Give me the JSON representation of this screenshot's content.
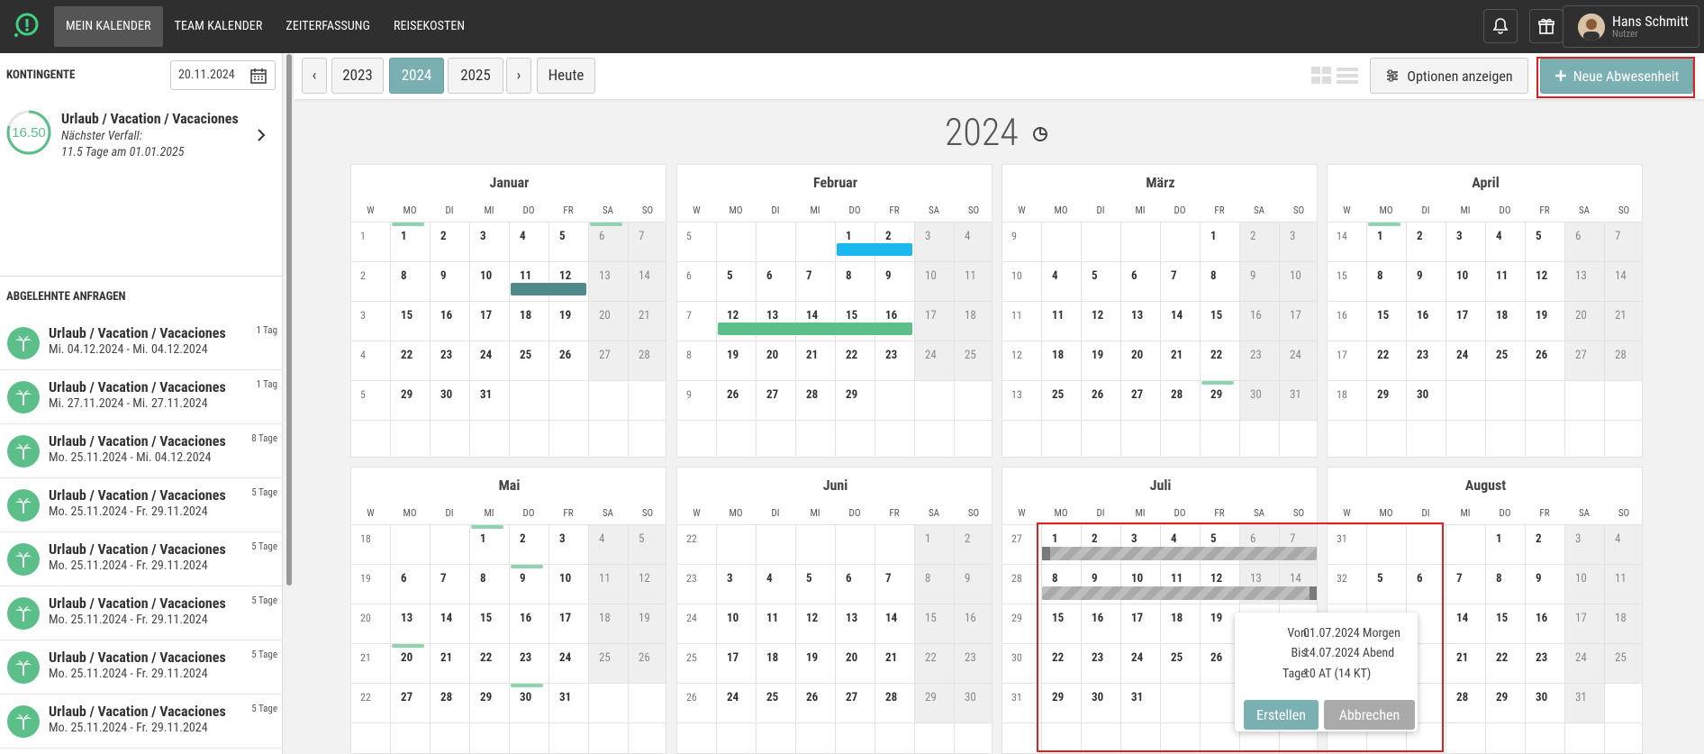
{
  "nav": {
    "items": [
      "MEIN KALENDER",
      "TEAM KALENDER",
      "ZEITERFASSUNG",
      "REISEKOSTEN"
    ]
  },
  "user": {
    "name": "Hans Schmitt",
    "role": "Nutzer"
  },
  "sidebar": {
    "kontingente_title": "KONTINGENTE",
    "date_value": "20.11.2024",
    "kontingent": {
      "value": "16.50",
      "fraction": 0.8,
      "title": "Urlaub / Vacation / Vacaciones",
      "line1": "Nächster Verfall:",
      "line2": "11.5 Tage am 01.01.2025"
    },
    "rejected_title": "ABGELEHNTE ANFRAGEN",
    "requests": [
      {
        "title": "Urlaub / Vacation / Vacaciones",
        "dates": "Mi. 04.12.2024 - Mi. 04.12.2024",
        "days": "1 Tag"
      },
      {
        "title": "Urlaub / Vacation / Vacaciones",
        "dates": "Mi. 27.11.2024 - Mi. 27.11.2024",
        "days": "1 Tag"
      },
      {
        "title": "Urlaub / Vacation / Vacaciones",
        "dates": "Mo. 25.11.2024 - Mi. 04.12.2024",
        "days": "8 Tage"
      },
      {
        "title": "Urlaub / Vacation / Vacaciones",
        "dates": "Mo. 25.11.2024 - Fr. 29.11.2024",
        "days": "5 Tage"
      },
      {
        "title": "Urlaub / Vacation / Vacaciones",
        "dates": "Mo. 25.11.2024 - Fr. 29.11.2024",
        "days": "5 Tage"
      },
      {
        "title": "Urlaub / Vacation / Vacaciones",
        "dates": "Mo. 25.11.2024 - Fr. 29.11.2024",
        "days": "5 Tage"
      },
      {
        "title": "Urlaub / Vacation / Vacaciones",
        "dates": "Mo. 25.11.2024 - Fr. 29.11.2024",
        "days": "5 Tage"
      },
      {
        "title": "Urlaub / Vacation / Vacaciones",
        "dates": "Mo. 25.11.2024 - Fr. 29.11.2024",
        "days": "5 Tage"
      }
    ]
  },
  "toolbar": {
    "prev_label": "‹",
    "years": [
      "2023",
      "2024",
      "2025"
    ],
    "next_label": "›",
    "today_label": "Heute",
    "options_label": "Optionen anzeigen",
    "new_absence_label": "Neue Abwesenheit"
  },
  "calendar": {
    "year": "2024",
    "weekday_labels": [
      "W",
      "MO",
      "DI",
      "MI",
      "DO",
      "FR",
      "SA",
      "SO"
    ],
    "months": [
      {
        "name": "Januar",
        "weeks": [
          {
            "kw": "1",
            "days": [
              "",
              "1",
              "2",
              "3",
              "4",
              "5",
              "6",
              "7"
            ]
          },
          {
            "kw": "2",
            "days": [
              "",
              "8",
              "9",
              "10",
              "11",
              "12",
              "13",
              "14"
            ]
          },
          {
            "kw": "3",
            "days": [
              "",
              "15",
              "16",
              "17",
              "18",
              "19",
              "20",
              "21"
            ]
          },
          {
            "kw": "4",
            "days": [
              "",
              "22",
              "23",
              "24",
              "25",
              "26",
              "27",
              "28"
            ]
          },
          {
            "kw": "5",
            "days": [
              "",
              "29",
              "30",
              "31",
              "",
              "",
              "",
              ""
            ]
          }
        ]
      },
      {
        "name": "Februar",
        "weeks": [
          {
            "kw": "5",
            "days": [
              "",
              "",
              "",
              "",
              "1",
              "2",
              "3",
              "4"
            ]
          },
          {
            "kw": "6",
            "days": [
              "",
              "5",
              "6",
              "7",
              "8",
              "9",
              "10",
              "11"
            ]
          },
          {
            "kw": "7",
            "days": [
              "",
              "12",
              "13",
              "14",
              "15",
              "16",
              "17",
              "18"
            ]
          },
          {
            "kw": "8",
            "days": [
              "",
              "19",
              "20",
              "21",
              "22",
              "23",
              "24",
              "25"
            ]
          },
          {
            "kw": "9",
            "days": [
              "",
              "26",
              "27",
              "28",
              "29",
              "",
              "",
              ""
            ]
          }
        ]
      },
      {
        "name": "März",
        "weeks": [
          {
            "kw": "9",
            "days": [
              "",
              "",
              "",
              "",
              "",
              "1",
              "2",
              "3"
            ]
          },
          {
            "kw": "10",
            "days": [
              "",
              "4",
              "5",
              "6",
              "7",
              "8",
              "9",
              "10"
            ]
          },
          {
            "kw": "11",
            "days": [
              "",
              "11",
              "12",
              "13",
              "14",
              "15",
              "16",
              "17"
            ]
          },
          {
            "kw": "12",
            "days": [
              "",
              "18",
              "19",
              "20",
              "21",
              "22",
              "23",
              "24"
            ]
          },
          {
            "kw": "13",
            "days": [
              "",
              "25",
              "26",
              "27",
              "28",
              "29",
              "30",
              "31"
            ]
          }
        ]
      },
      {
        "name": "April",
        "weeks": [
          {
            "kw": "14",
            "days": [
              "",
              "1",
              "2",
              "3",
              "4",
              "5",
              "6",
              "7"
            ]
          },
          {
            "kw": "15",
            "days": [
              "",
              "8",
              "9",
              "10",
              "11",
              "12",
              "13",
              "14"
            ]
          },
          {
            "kw": "16",
            "days": [
              "",
              "15",
              "16",
              "17",
              "18",
              "19",
              "20",
              "21"
            ]
          },
          {
            "kw": "17",
            "days": [
              "",
              "22",
              "23",
              "24",
              "25",
              "26",
              "27",
              "28"
            ]
          },
          {
            "kw": "18",
            "days": [
              "",
              "29",
              "30",
              "",
              "",
              "",
              "",
              ""
            ]
          }
        ]
      },
      {
        "name": "Mai",
        "weeks": [
          {
            "kw": "18",
            "days": [
              "",
              "",
              "",
              "1",
              "2",
              "3",
              "4",
              "5"
            ]
          },
          {
            "kw": "19",
            "days": [
              "",
              "6",
              "7",
              "8",
              "9",
              "10",
              "11",
              "12"
            ]
          },
          {
            "kw": "20",
            "days": [
              "",
              "13",
              "14",
              "15",
              "16",
              "17",
              "18",
              "19"
            ]
          },
          {
            "kw": "21",
            "days": [
              "",
              "20",
              "21",
              "22",
              "23",
              "24",
              "25",
              "26"
            ]
          },
          {
            "kw": "22",
            "days": [
              "",
              "27",
              "28",
              "29",
              "30",
              "31",
              "",
              ""
            ]
          }
        ]
      },
      {
        "name": "Juni",
        "weeks": [
          {
            "kw": "22",
            "days": [
              "",
              "",
              "",
              "",
              "",
              "",
              "1",
              "2"
            ]
          },
          {
            "kw": "23",
            "days": [
              "",
              "3",
              "4",
              "5",
              "6",
              "7",
              "8",
              "9"
            ]
          },
          {
            "kw": "24",
            "days": [
              "",
              "10",
              "11",
              "12",
              "13",
              "14",
              "15",
              "16"
            ]
          },
          {
            "kw": "25",
            "days": [
              "",
              "17",
              "18",
              "19",
              "20",
              "21",
              "22",
              "23"
            ]
          },
          {
            "kw": "26",
            "days": [
              "",
              "24",
              "25",
              "26",
              "27",
              "28",
              "29",
              "30"
            ]
          }
        ]
      },
      {
        "name": "Juli",
        "weeks": [
          {
            "kw": "27",
            "days": [
              "",
              "1",
              "2",
              "3",
              "4",
              "5",
              "6",
              "7"
            ]
          },
          {
            "kw": "28",
            "days": [
              "",
              "8",
              "9",
              "10",
              "11",
              "12",
              "13",
              "14"
            ]
          },
          {
            "kw": "29",
            "days": [
              "",
              "15",
              "16",
              "17",
              "18",
              "19",
              "",
              ""
            ]
          },
          {
            "kw": "30",
            "days": [
              "",
              "22",
              "23",
              "24",
              "25",
              "26",
              "",
              ""
            ]
          },
          {
            "kw": "31",
            "days": [
              "",
              "29",
              "30",
              "31",
              "",
              "",
              "",
              ""
            ]
          }
        ]
      },
      {
        "name": "August",
        "weeks": [
          {
            "kw": "31",
            "days": [
              "",
              "",
              "",
              "",
              "1",
              "2",
              "3",
              "4"
            ]
          },
          {
            "kw": "32",
            "days": [
              "",
              "5",
              "6",
              "7",
              "8",
              "9",
              "10",
              "11"
            ]
          },
          {
            "kw": "",
            "days": [
              "",
              "",
              "",
              "14",
              "15",
              "16",
              "17",
              "18"
            ]
          },
          {
            "kw": "",
            "days": [
              "",
              "",
              "",
              "21",
              "22",
              "23",
              "24",
              "25"
            ]
          },
          {
            "kw": "",
            "days": [
              "",
              "",
              "",
              "28",
              "29",
              "30",
              "31",
              ""
            ]
          }
        ]
      }
    ],
    "marks": [
      {
        "month": 0,
        "week": 0,
        "col": 1
      },
      {
        "month": 0,
        "week": 0,
        "col": 6
      },
      {
        "month": 2,
        "week": 4,
        "col": 5
      },
      {
        "month": 3,
        "week": 0,
        "col": 1
      },
      {
        "month": 4,
        "week": 0,
        "col": 3
      },
      {
        "month": 4,
        "week": 1,
        "col": 4
      },
      {
        "month": 4,
        "week": 3,
        "col": 1
      },
      {
        "month": 4,
        "week": 4,
        "col": 4
      }
    ],
    "bars": [
      {
        "month": 0,
        "week": 1,
        "from": 4,
        "to": 5,
        "color": "#4f8a8b"
      },
      {
        "month": 1,
        "week": 0,
        "from": 4,
        "to": 5,
        "color": "#1ab8ef"
      },
      {
        "month": 1,
        "week": 2,
        "from": 1,
        "to": 5,
        "color": "#5cbf8a"
      }
    ],
    "selection": [
      {
        "month": 6,
        "week": 0,
        "from": 1,
        "to": 7,
        "handle": "start"
      },
      {
        "month": 6,
        "week": 1,
        "from": 1,
        "to": 7,
        "handle": "end"
      }
    ]
  },
  "popup": {
    "von_label": "Von:",
    "von_value": "01.07.2024 Morgen",
    "bis_label": "Bis:",
    "bis_value": "14.07.2024 Abend",
    "tage_label": "Tage:",
    "tage_value": "10 AT (14 KT)",
    "create_label": "Erstellen",
    "cancel_label": "Abbrechen"
  },
  "colors": {
    "accent": "#7bb0b3",
    "mark": "#8fd4ae",
    "highlight": "#e02020"
  }
}
